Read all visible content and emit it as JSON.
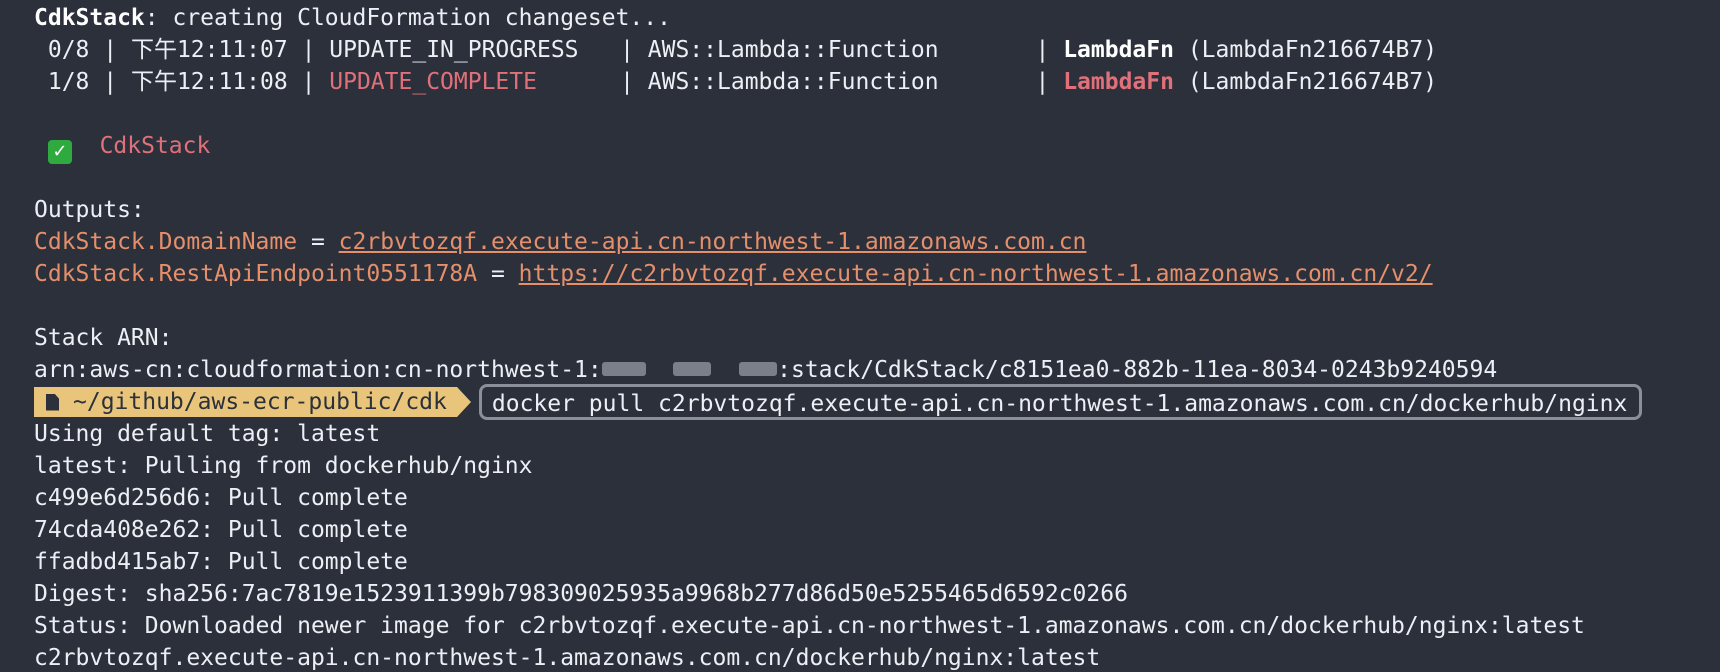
{
  "header": {
    "stack_name": "CdkStack",
    "status_text": ": creating CloudFormation changeset..."
  },
  "events": [
    {
      "progress": " 0/8",
      "time": "下午12:11:07",
      "status": "UPDATE_IN_PROGRESS  ",
      "resource_type": "AWS::Lambda::Function      ",
      "logical_id": "LambdaFn",
      "physical_id": " (LambdaFn216674B7)"
    },
    {
      "progress": " 1/8",
      "time": "下午12:11:08",
      "status": "UPDATE_COMPLETE     ",
      "resource_type": "AWS::Lambda::Function      ",
      "logical_id": "LambdaFn",
      "physical_id": " (LambdaFn216674B7)"
    }
  ],
  "deploy_result": {
    "check_glyph": "✓",
    "stack": "CdkStack"
  },
  "outputs": {
    "heading": "Outputs:",
    "items": [
      {
        "stack": "CdkStack",
        "key": ".DomainName",
        "eq": " = ",
        "value": "c2rbvtozqf.execute-api.cn-northwest-1.amazonaws.com.cn"
      },
      {
        "stack": "CdkStack",
        "key": ".RestApiEndpoint0551178A",
        "eq": " = ",
        "value": "https://c2rbvtozqf.execute-api.cn-northwest-1.amazonaws.com.cn/v2/"
      }
    ]
  },
  "arn": {
    "heading": "Stack ARN:",
    "prefix": "arn:aws-cn:cloudformation:cn-northwest-1:",
    "suffix": ":stack/CdkStack/c8151ea0-882b-11ea-8034-0243b9240594"
  },
  "prompt": {
    "path": "~/github/aws-ecr-public/cdk",
    "command": "docker pull c2rbvtozqf.execute-api.cn-northwest-1.amazonaws.com.cn/dockerhub/nginx"
  },
  "docker_output": [
    "Using default tag: latest",
    "latest: Pulling from dockerhub/nginx",
    "c499e6d256d6: Pull complete",
    "74cda408e262: Pull complete",
    "ffadbd415ab7: Pull complete",
    "Digest: sha256:7ac7819e1523911399b798309025935a9968b277d86d50e5255465d6592c0266",
    "Status: Downloaded newer image for c2rbvtozqf.execute-api.cn-northwest-1.amazonaws.com.cn/dockerhub/nginx:latest",
    "c2rbvtozqf.execute-api.cn-northwest-1.amazonaws.com.cn/dockerhub/nginx:latest"
  ],
  "colors": {
    "background": "#2b303b",
    "text": "#eceff4",
    "error_red": "#e0707a",
    "output_orange": "#e58f6b",
    "prompt_yellow": "#e8c57a",
    "check_green": "#2faa3f"
  }
}
